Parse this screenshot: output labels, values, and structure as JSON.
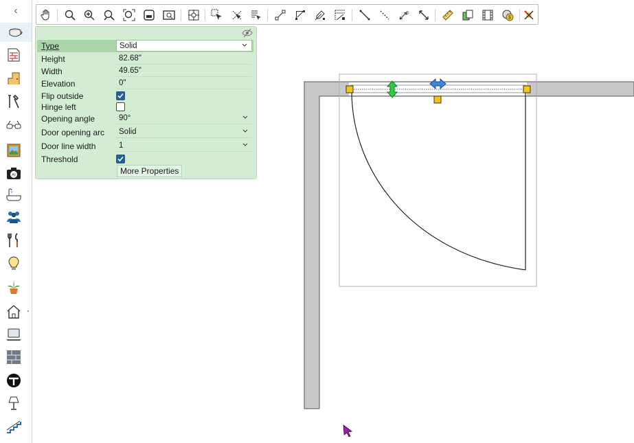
{
  "sidebar": {
    "collapse_glyph": "‹",
    "items": [
      {
        "icon": "cup-icon",
        "active": true
      },
      {
        "icon": "brick-wall-icon"
      },
      {
        "icon": "door-icon"
      },
      {
        "icon": "tools-icon"
      },
      {
        "icon": "glasses-icon"
      },
      {
        "icon": "picture-frame-icon"
      },
      {
        "icon": "ai-camera-icon"
      },
      {
        "icon": "bathtub-icon"
      },
      {
        "icon": "people-icon"
      },
      {
        "icon": "kitchen-utensils-icon"
      },
      {
        "icon": "light-bulb-icon"
      },
      {
        "icon": "plant-icon"
      },
      {
        "icon": "house-icon"
      },
      {
        "icon": "laptop-icon"
      },
      {
        "icon": "floor-tile-icon"
      },
      {
        "icon": "table-icon"
      },
      {
        "icon": "lamp-icon"
      },
      {
        "icon": "stairs-icon"
      }
    ]
  },
  "toolbar": {
    "buttons": [
      "pan-hand-icon",
      "zoom-icon",
      "zoom-in-icon",
      "zoom-out-icon",
      "zoom-fit-icon",
      "zoom-window-icon",
      "zoom-preview-icon",
      "center-target-icon",
      "select-arrow-icon",
      "deselect-icon",
      "select-list-icon",
      "line-connect-icon",
      "snap-corner-icon",
      "snap-edit-icon",
      "snap-grid-icon",
      "draw-line-icon",
      "dotted-line-icon",
      "dimension-3-icon",
      "resize-diagonal-icon",
      "ruler-icon",
      "copy-paint-icon",
      "film-icon",
      "cost-icon",
      "delete-x-icon"
    ]
  },
  "properties": {
    "type_label": "Type",
    "type_value": "Solid",
    "height_label": "Height",
    "height_value": "82.68\"",
    "width_label": "Width",
    "width_value": "49.65\"",
    "elevation_label": "Elevation",
    "elevation_value": "0\"",
    "flip_outside_label": "Flip outside",
    "flip_outside_checked": true,
    "hinge_left_label": "Hinge left",
    "hinge_left_checked": false,
    "opening_angle_label": "Opening angle",
    "opening_angle_value": "90°",
    "door_opening_arc_label": "Door opening arc",
    "door_opening_arc_value": "Solid",
    "door_line_width_label": "Door line width",
    "door_line_width_value": "1",
    "threshold_label": "Threshold",
    "threshold_checked": true,
    "more_properties_label": "More Properties"
  },
  "colors": {
    "panel_bg": "#d4ecd4",
    "wall_fill": "#c8c8c8",
    "handle_yellow": "#f5c518",
    "handle_green": "#2ecc40",
    "handle_blue": "#3a86e0",
    "cursor": "#9b1fa8"
  }
}
